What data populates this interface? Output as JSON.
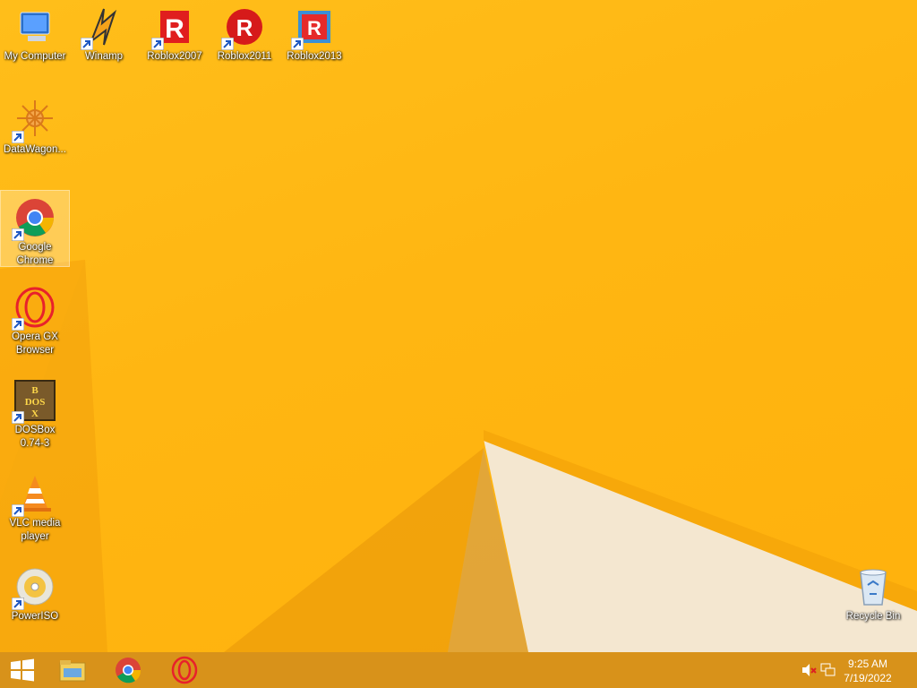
{
  "desktop": {
    "icons": [
      {
        "label": "My Computer"
      },
      {
        "label": "Winamp"
      },
      {
        "label": "Roblox2007"
      },
      {
        "label": "Roblox2011"
      },
      {
        "label": "Roblox2013"
      },
      {
        "label": "DataWagon..."
      },
      {
        "label": "Google Chrome"
      },
      {
        "label": "Opera GX Browser"
      },
      {
        "label": "DOSBox 0.74-3"
      },
      {
        "label": "VLC media player"
      },
      {
        "label": "PowerISO"
      },
      {
        "label": "Recycle Bin"
      }
    ]
  },
  "taskbar": {
    "pinned": [
      "start-button",
      "file-explorer",
      "google-chrome",
      "opera-gx"
    ],
    "clock": {
      "time": "9:25 AM",
      "date": "7/19/2022"
    },
    "tray_icons": [
      "volume-muted-icon",
      "network-icon"
    ]
  },
  "colors": {
    "wallpaper": "#ffb612",
    "taskbar": "#d8921a"
  }
}
